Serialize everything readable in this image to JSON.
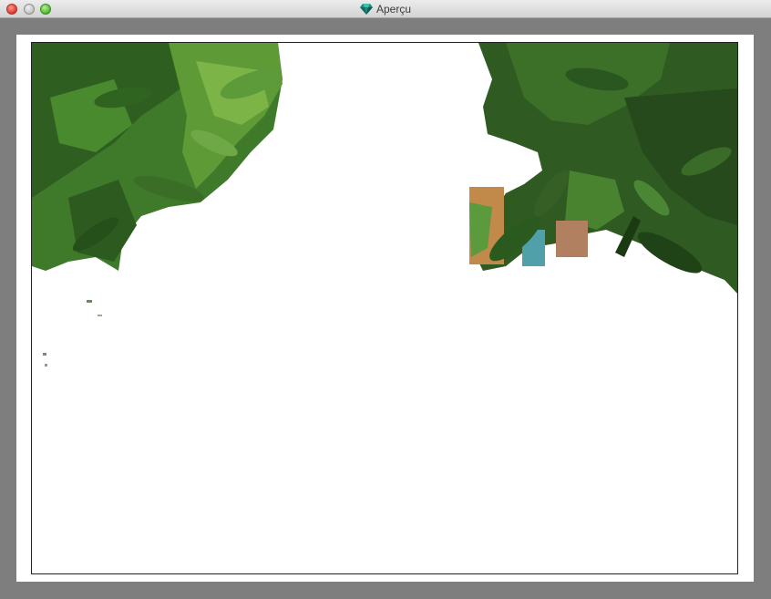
{
  "window": {
    "title": "Aperçu",
    "app_icon": "gem-icon"
  },
  "controls": [
    "close-button",
    "minimize-button",
    "zoom-button"
  ],
  "image": {
    "subject": "photo-foliage-cutout",
    "colors": {
      "leaf_dark": "#2f5a22",
      "leaf_mid": "#3f7a2c",
      "leaf_light": "#6fa53c",
      "background": "#ffffff",
      "window_gray": "#7e7e7e"
    }
  }
}
